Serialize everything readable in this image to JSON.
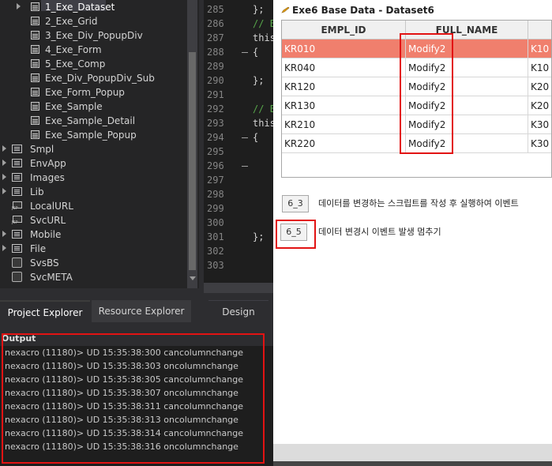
{
  "explorer": {
    "items": [
      {
        "label": "1_Exe_Dataset",
        "kind": "file",
        "selected": true
      },
      {
        "label": "2_Exe_Grid",
        "kind": "file"
      },
      {
        "label": "3_Exe_Div_PopupDiv",
        "kind": "file"
      },
      {
        "label": "4_Exe_Form",
        "kind": "file"
      },
      {
        "label": "5_Exe_Comp",
        "kind": "file"
      },
      {
        "label": "Exe_Div_PopupDiv_Sub",
        "kind": "file"
      },
      {
        "label": "Exe_Form_Popup",
        "kind": "file"
      },
      {
        "label": "Exe_Sample",
        "kind": "file"
      },
      {
        "label": "Exe_Sample_Detail",
        "kind": "file"
      },
      {
        "label": "Exe_Sample_Popup",
        "kind": "file"
      },
      {
        "label": "Smpl",
        "kind": "folder"
      },
      {
        "label": "EnvApp",
        "kind": "folder"
      },
      {
        "label": "Images",
        "kind": "folder"
      },
      {
        "label": "Lib",
        "kind": "folder"
      },
      {
        "label": "LocalURL",
        "kind": "url"
      },
      {
        "label": "SvcURL",
        "kind": "url"
      },
      {
        "label": "Mobile",
        "kind": "folder"
      },
      {
        "label": "File",
        "kind": "folder"
      },
      {
        "label": "SvsBS",
        "kind": "svc"
      },
      {
        "label": "SvcMETA",
        "kind": "svc"
      }
    ],
    "tabs": [
      {
        "label": "Project Explorer",
        "active": true
      },
      {
        "label": "Resource Explorer",
        "active": false
      }
    ]
  },
  "editor": {
    "line_numbers": [
      "285",
      "286",
      "287",
      "288",
      "289",
      "290",
      "291",
      "292",
      "293",
      "294",
      "295",
      "296",
      "297",
      "298",
      "299",
      "300",
      "301",
      "302",
      "303"
    ],
    "code_lines": [
      {
        "line": "285",
        "text": "};",
        "color": "#d4d4d4"
      },
      {
        "line": "286",
        "text": "// E",
        "color": "#57a64a"
      },
      {
        "line": "287",
        "text": "this",
        "color": "#d4d4d4"
      },
      {
        "line": "288",
        "text": "{",
        "color": "#d4d4d4"
      },
      {
        "line": "290",
        "text": "};",
        "color": "#d4d4d4"
      },
      {
        "line": "292",
        "text": "// E",
        "color": "#57a64a"
      },
      {
        "line": "293",
        "text": "this",
        "color": "#d4d4d4"
      },
      {
        "line": "294",
        "text": "{",
        "color": "#d4d4d4"
      },
      {
        "line": "301",
        "text": "};",
        "color": "#d4d4d4"
      }
    ],
    "design_tab": "Design"
  },
  "output": {
    "title": "Output",
    "lines": [
      "nexacro (11180)> UD 15:35:38:300 cancolumnchange",
      "nexacro (11180)> UD 15:35:38:303 oncolumnchange",
      "nexacro (11180)> UD 15:35:38:305 cancolumnchange",
      "nexacro (11180)> UD 15:35:38:307 oncolumnchange",
      "nexacro (11180)> UD 15:35:38:311 cancolumnchange",
      "nexacro (11180)> UD 15:35:38:313 oncolumnchange",
      "nexacro (11180)> UD 15:35:38:314 cancolumnchange",
      "nexacro (11180)> UD 15:35:38:316 oncolumnchange"
    ]
  },
  "preview": {
    "title": "Exe6 Base Data - Dataset6",
    "grid": {
      "columns": [
        "EMPL_ID",
        "FULL_NAME",
        ""
      ],
      "rows": [
        {
          "id": "KR010",
          "name": "Modify2",
          "dept": "K10",
          "selected": true
        },
        {
          "id": "KR040",
          "name": "Modify2",
          "dept": "K10"
        },
        {
          "id": "KR120",
          "name": "Modify2",
          "dept": "K20"
        },
        {
          "id": "KR130",
          "name": "Modify2",
          "dept": "K20"
        },
        {
          "id": "KR210",
          "name": "Modify2",
          "dept": "K30"
        },
        {
          "id": "KR220",
          "name": "Modify2",
          "dept": "K30"
        }
      ]
    },
    "buttons": [
      {
        "label": "6_3",
        "note": "데이터를 변경하는 스크립트를 작성 후 실행하여 이벤트"
      },
      {
        "label": "6_5",
        "note": "데이터 변경시 이벤트 발생 멈추기"
      }
    ]
  },
  "colors": {
    "highlight_box": "#e21313",
    "selected_row": "#f07f6d",
    "ide_bg": "#252526"
  }
}
